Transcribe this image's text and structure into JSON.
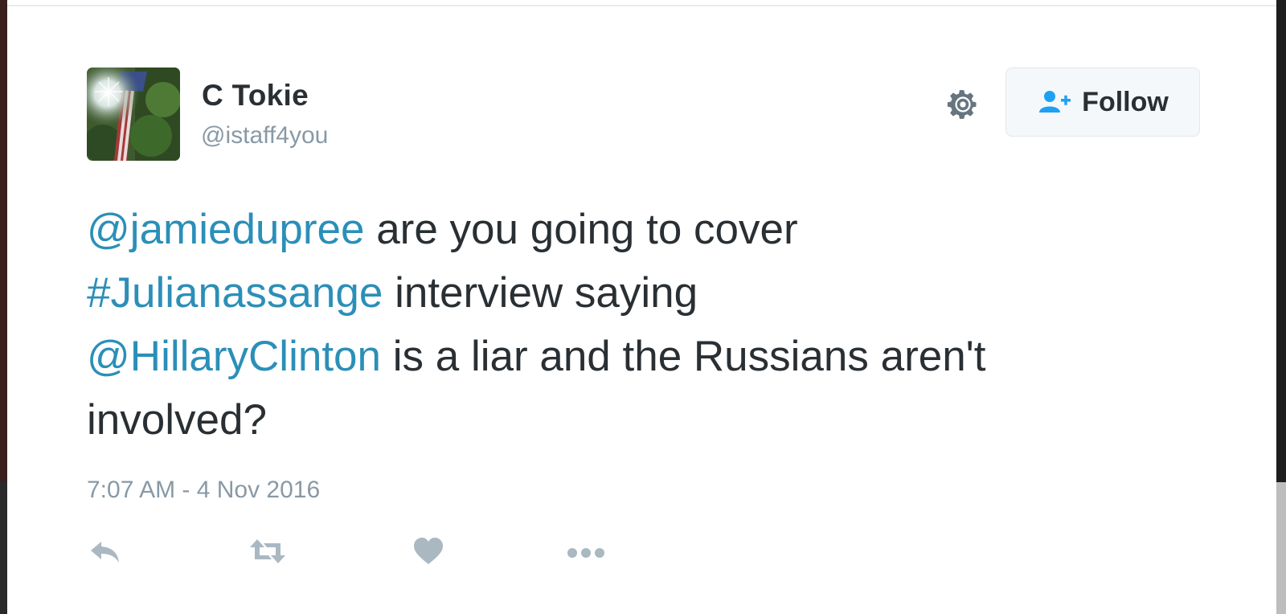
{
  "user": {
    "display_name": "C Tokie",
    "handle": "@istaff4you"
  },
  "follow_button": {
    "label": "Follow"
  },
  "tweet": {
    "segments": [
      {
        "text": "@jamiedupree",
        "type": "mention"
      },
      {
        "text": " are you going to cover ",
        "type": "text"
      },
      {
        "text": "#Julianassange",
        "type": "hashtag"
      },
      {
        "text": " interview saying ",
        "type": "text"
      },
      {
        "text": "@HillaryClinton",
        "type": "mention"
      },
      {
        "text": " is a liar and the Russians aren't involved?",
        "type": "text"
      }
    ],
    "timestamp": "7:07 AM - 4 Nov 2016"
  },
  "icons": {
    "gear": "gear-icon",
    "follow": "follow-user-icon",
    "reply": "reply-icon",
    "retweet": "retweet-icon",
    "like": "heart-icon",
    "more": "more-icon"
  },
  "colors": {
    "link": "#2b8fb8",
    "text": "#292f33",
    "muted": "#8899a6",
    "follow_icon": "#1da1f2"
  }
}
